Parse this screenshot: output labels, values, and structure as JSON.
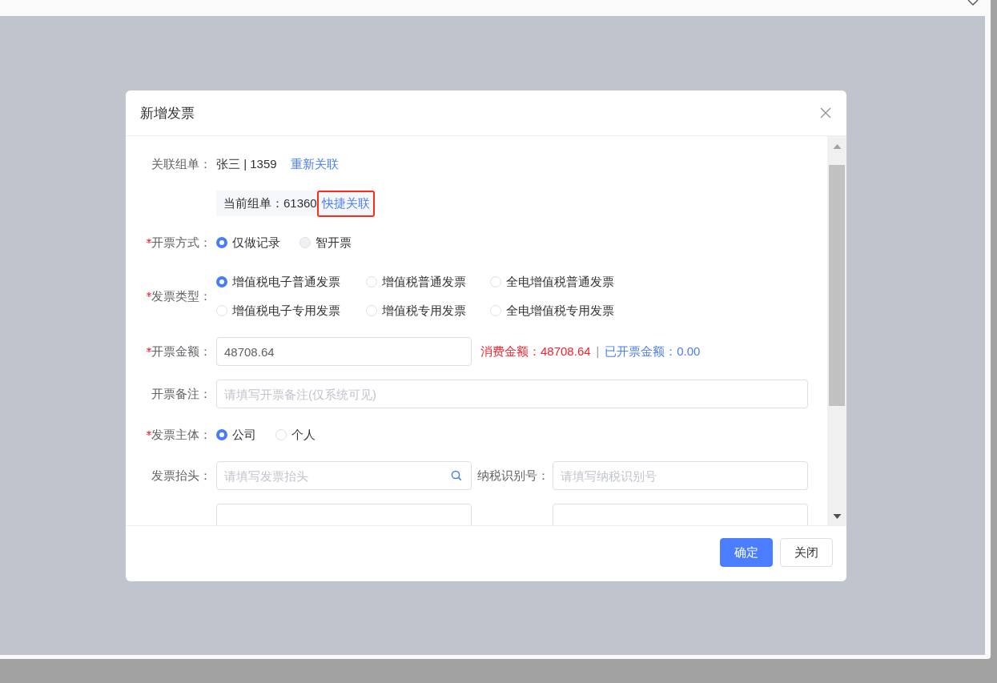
{
  "dialog": {
    "title": "新增发票",
    "form": [
      {
        "kind": "text",
        "label": "关联组单：",
        "required": false,
        "value": "张三 | 1359",
        "link": "重新关联"
      },
      {
        "kind": "chip",
        "text": "当前组单：61360",
        "link": "快捷关联",
        "highlighted": true
      },
      {
        "kind": "radio",
        "label": "开票方式：",
        "required": true,
        "options": [
          {
            "label": "仅做记录",
            "selected": true,
            "disabled": false
          },
          {
            "label": "智开票",
            "selected": false,
            "disabled": true
          }
        ]
      },
      {
        "kind": "radio_grid",
        "label": "发票类型：",
        "required": true,
        "options": [
          {
            "label": "增值税电子普通发票",
            "selected": true,
            "disabled": false
          },
          {
            "label": "增值税普通发票",
            "selected": false,
            "disabled": false
          },
          {
            "label": "全电增值税普通发票",
            "selected": false,
            "disabled": false
          },
          {
            "label": "增值税电子专用发票",
            "selected": false,
            "disabled": false
          },
          {
            "label": "增值税专用发票",
            "selected": false,
            "disabled": false
          },
          {
            "label": "全电增值税专用发票",
            "selected": false,
            "disabled": false
          }
        ]
      },
      {
        "kind": "amount",
        "label": "开票金额：",
        "required": true,
        "value": "48708.64",
        "consumed": "消费金额：48708.64",
        "separator": "|",
        "invoiced": "已开票金额：0.00"
      },
      {
        "kind": "input",
        "label": "开票备注：",
        "required": false,
        "placeholder": "请填写开票备注(仅系统可见)"
      },
      {
        "kind": "radio",
        "label": "发票主体：",
        "required": true,
        "options": [
          {
            "label": "公司",
            "selected": true,
            "disabled": false
          },
          {
            "label": "个人",
            "selected": false,
            "disabled": false
          }
        ]
      },
      {
        "kind": "pair",
        "fields": [
          {
            "label": "发票抬头：",
            "placeholder": "请填写发票抬头",
            "search": true
          },
          {
            "label": "纳税识别号：",
            "placeholder": "请填写纳税识别号",
            "search": false
          }
        ]
      },
      {
        "kind": "pair",
        "fields": [
          {
            "search": false
          },
          {
            "search": false
          }
        ]
      }
    ],
    "buttons": [
      {
        "label": "确定",
        "primary": true
      },
      {
        "label": "关闭",
        "primary": false
      }
    ]
  }
}
